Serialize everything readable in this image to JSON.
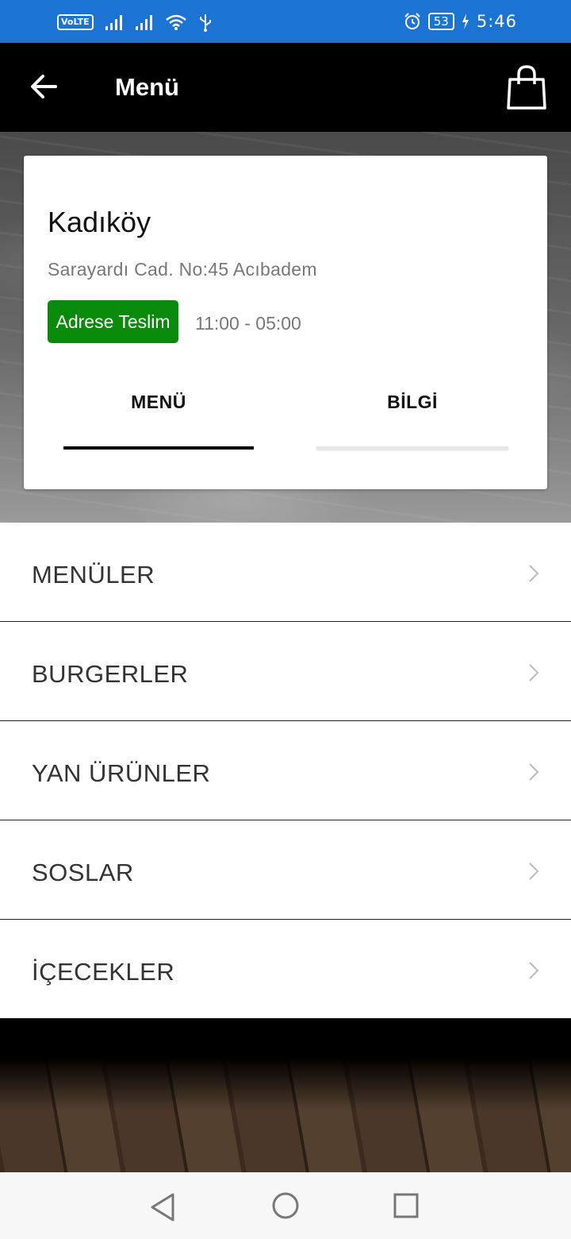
{
  "status_bar": {
    "volte_label": "VoLTE",
    "battery_level": "53",
    "time": "5:46",
    "icons": [
      "volte-icon",
      "signal-icon",
      "signal-icon",
      "wifi-icon",
      "usb-icon",
      "alarm-icon",
      "battery-icon",
      "charging-icon"
    ]
  },
  "app_bar": {
    "title": "Menü",
    "back_icon": "arrow-left-icon",
    "cart_icon": "shopping-bag-icon"
  },
  "store": {
    "name": "Kadıköy",
    "address": "Sarayardı Cad. No:45 Acıbadem",
    "delivery_label": "Adrese Teslim",
    "delivery_color": "#0a8a0a",
    "hours": "11:00 - 05:00"
  },
  "tabs": [
    {
      "label": "MENÜ",
      "active": true
    },
    {
      "label": "BİLGİ",
      "active": false
    }
  ],
  "categories": [
    {
      "label": "MENÜLER"
    },
    {
      "label": "BURGERLER"
    },
    {
      "label": "YAN ÜRÜNLER"
    },
    {
      "label": "SOSLAR"
    },
    {
      "label": "İÇECEKLER"
    }
  ],
  "nav_bar": {
    "icons": [
      "back-triangle-icon",
      "home-circle-icon",
      "recents-square-icon"
    ]
  },
  "colors": {
    "status_bar": "#1b74d3",
    "app_bar": "#000000",
    "accent_green": "#0a8a0a"
  }
}
